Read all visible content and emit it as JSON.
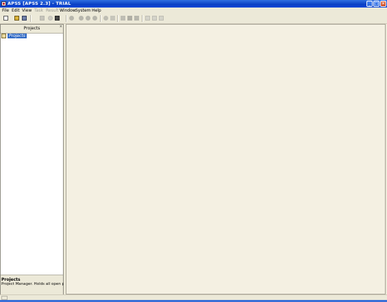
{
  "window": {
    "title": "APSS [APSS 2.3] - TRIAL",
    "minimize_glyph": "_",
    "maximize_glyph": "□",
    "close_glyph": "✕"
  },
  "menu": [
    {
      "label": "File",
      "enabled": true
    },
    {
      "label": "Edit",
      "enabled": true
    },
    {
      "label": "View",
      "enabled": true
    },
    {
      "label": "Task",
      "enabled": false
    },
    {
      "label": "Result",
      "enabled": false
    },
    {
      "label": "Window",
      "enabled": true
    },
    {
      "label": "System",
      "enabled": true
    },
    {
      "label": "Help",
      "enabled": true
    }
  ],
  "toolbar": {
    "icons": [
      "new-document-icon",
      "open-project-icon",
      "save-icon",
      "copy-icon",
      "delete-icon",
      "print-icon",
      "task-run-icon",
      "step-back-icon",
      "record-icon",
      "step-forward-icon",
      "analyze-icon",
      "chart-icon",
      "layout-icon",
      "grid-icon",
      "window-icon",
      "tile-horizontal-icon",
      "tile-vertical-icon",
      "cascade-icon"
    ]
  },
  "projects_panel": {
    "title": "Projects",
    "close_glyph": "×",
    "root_node": "Projects",
    "info_title": "Projects",
    "info_description": "Project Manager. Holds all open projects."
  },
  "colors": {
    "title_bar": "#0a3fc4",
    "selection": "#316ac5",
    "workspace": "#f4f0e2",
    "chrome": "#ece9d8"
  }
}
